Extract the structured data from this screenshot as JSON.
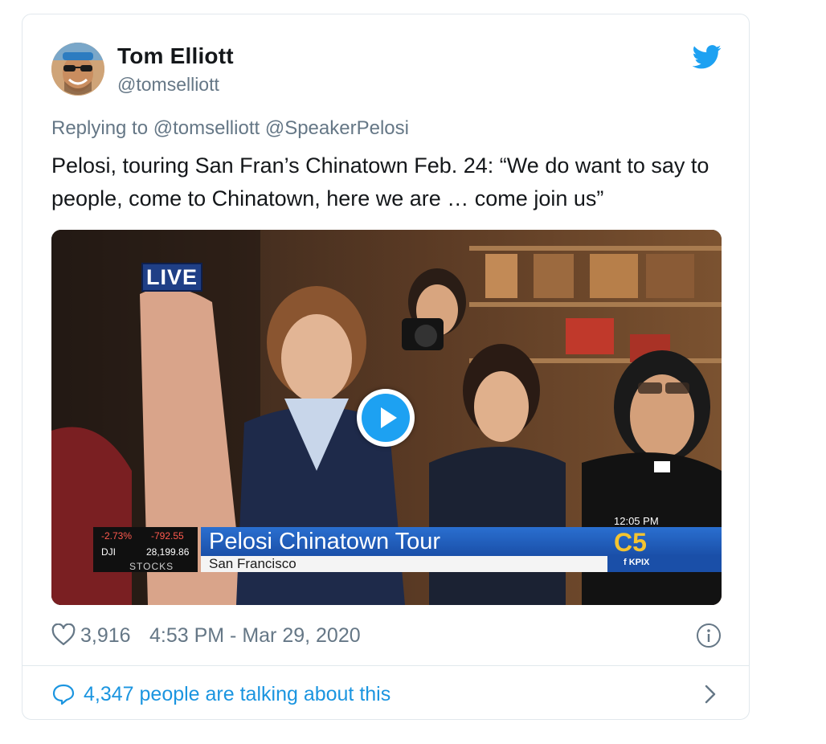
{
  "author": {
    "name": "Tom Elliott",
    "handle": "@tomselliott"
  },
  "icons": {
    "platform": "twitter-bird-icon",
    "like": "heart-icon",
    "info": "info-icon",
    "reply": "speech-bubble-icon",
    "more": "chevron-right-icon"
  },
  "reply": {
    "prefix": "Replying to",
    "mentions": [
      "@tomselliott",
      "@SpeakerPelosi"
    ]
  },
  "tweet": {
    "text": "Pelosi, touring San Fran’s Chinatown Feb. 24: “We do want to say to people, come to Chinatown, here we are … come join us”"
  },
  "video": {
    "live_badge": "LIVE",
    "headline": "Pelosi Chinatown Tour",
    "location": "San Francisco",
    "clock": "12:05 PM",
    "station_logo": "C5",
    "station_tag": "f KPIX",
    "stocks": {
      "pct": "-2.73%",
      "change": "-792.55",
      "index": "DJI",
      "value": "28,199.86",
      "label": "STOCKS"
    }
  },
  "meta": {
    "likes": "3,916",
    "timestamp": "4:53 PM - Mar 29, 2020"
  },
  "footer": {
    "talking": "4,347 people are talking about this"
  },
  "colors": {
    "accent": "#1da1f2",
    "link": "#1b95e0",
    "secondary_text": "#657786",
    "border": "#e1e8ed"
  }
}
